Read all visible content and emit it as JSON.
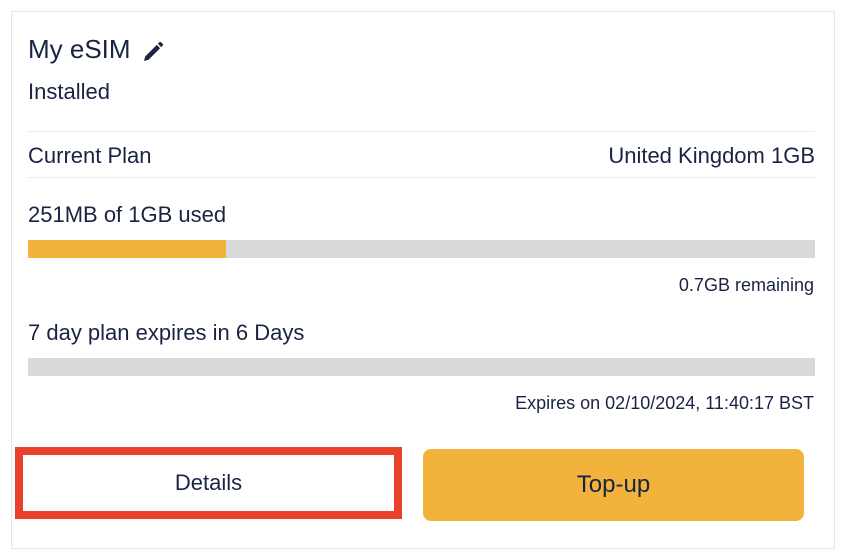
{
  "esim": {
    "name": "My eSIM",
    "edit_icon": "pencil-icon",
    "status": "Installed"
  },
  "plan": {
    "label": "Current Plan",
    "value": "United Kingdom 1GB"
  },
  "usage": {
    "label": "251MB of 1GB used",
    "used_fraction": 0.251,
    "remaining_text": "0.7GB remaining"
  },
  "expiry": {
    "label": "7 day plan expires in 6 Days",
    "elapsed_fraction": 0,
    "expires_text": "Expires on 02/10/2024, 11:40:17 BST"
  },
  "actions": {
    "details_label": "Details",
    "topup_label": "Top-up"
  },
  "colors": {
    "accent": "#f2b33d",
    "text": "#1b2343",
    "track": "#d9d9d9",
    "highlight_border": "#e8432a"
  }
}
